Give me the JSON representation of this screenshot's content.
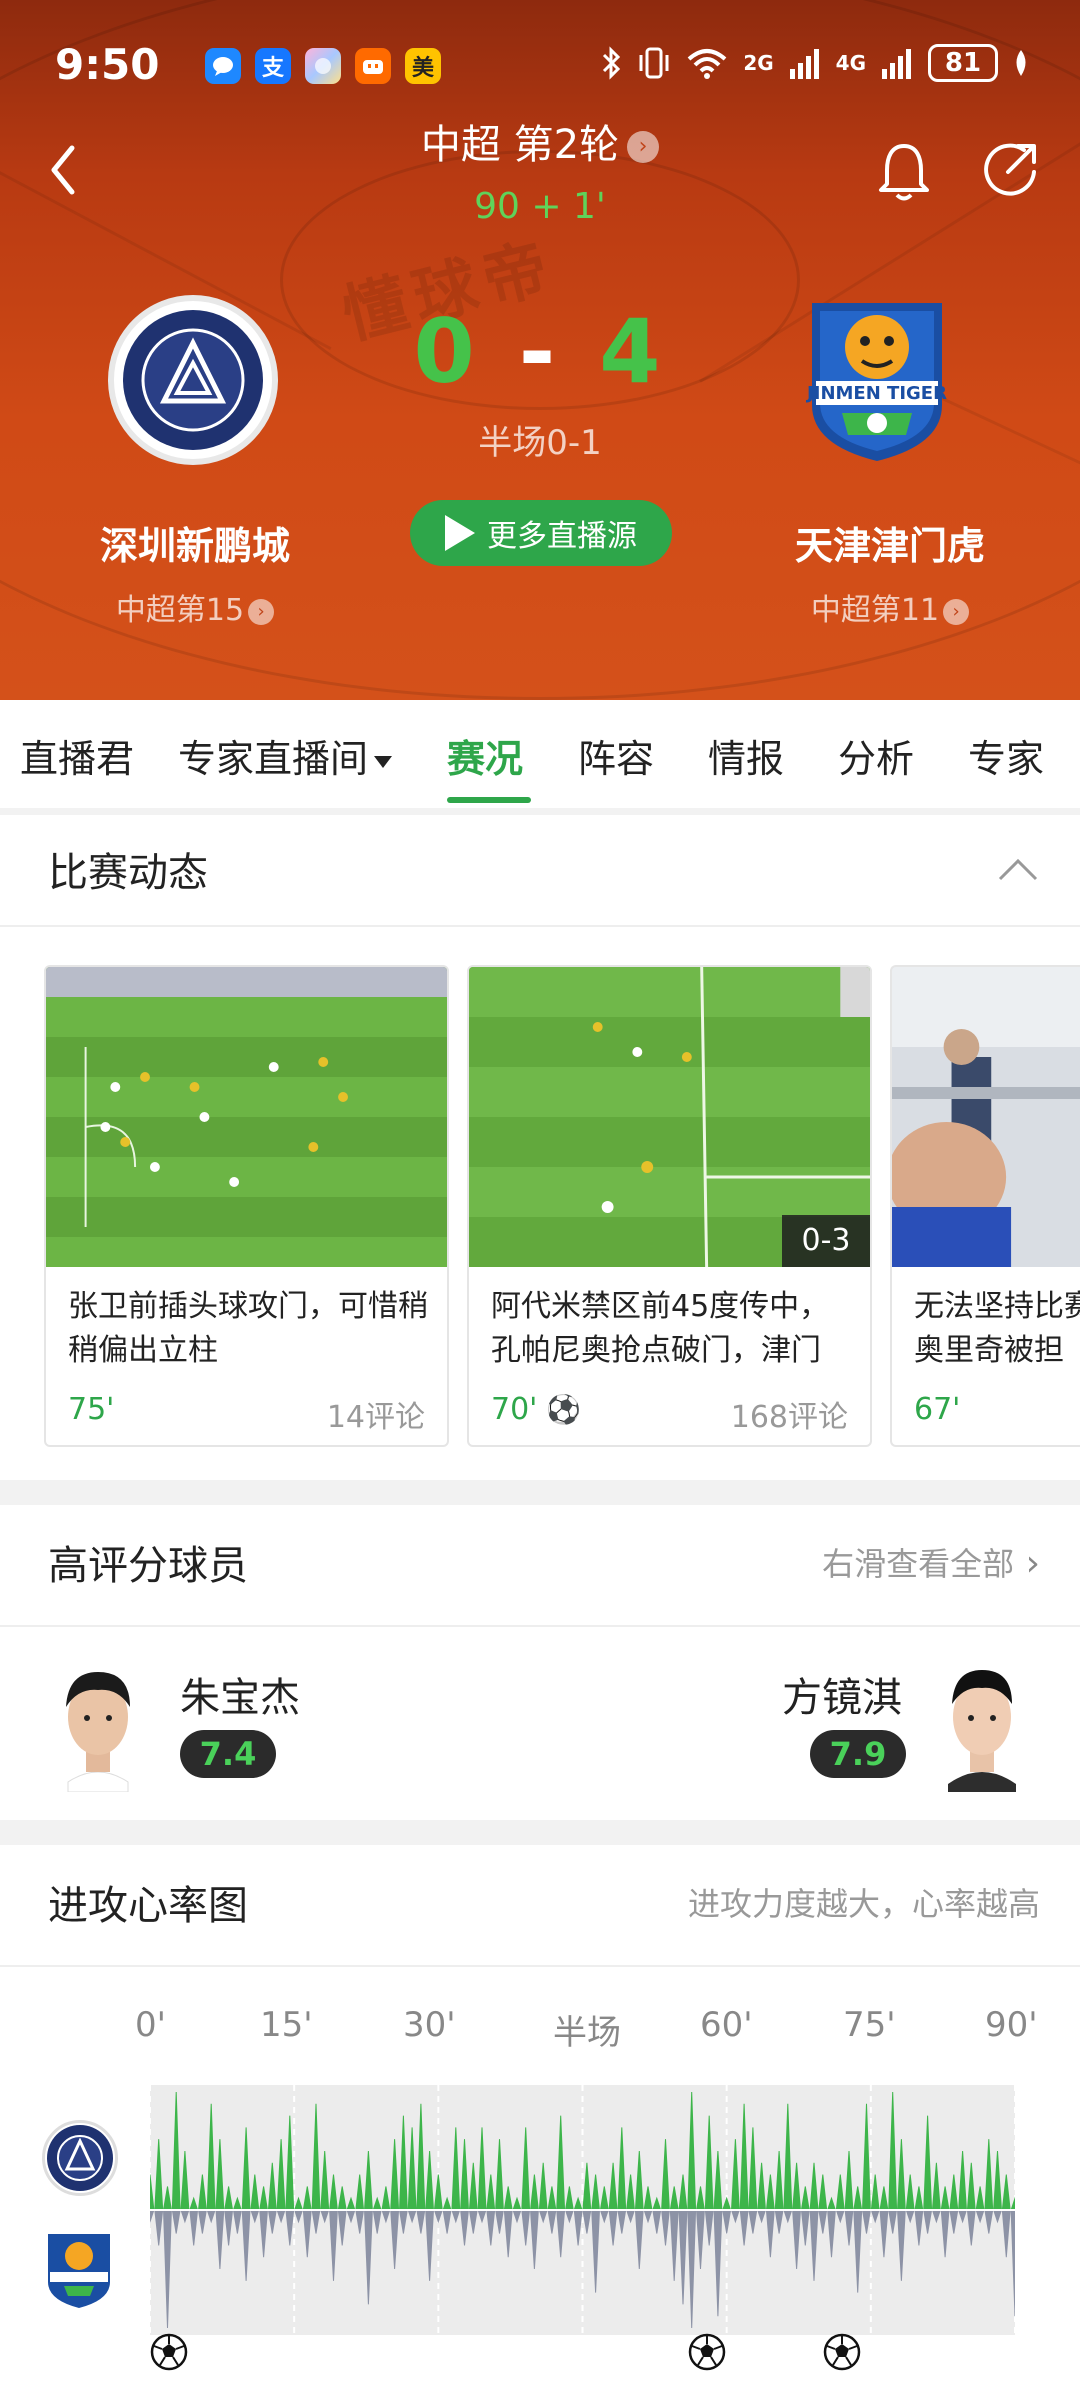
{
  "status_bar": {
    "time": "9:50",
    "app_icons": [
      "message-app",
      "alipay-app",
      "photos-app",
      "taobao-app",
      "meituan-app"
    ],
    "app_glyphs": [
      "",
      "支",
      "",
      "",
      "美"
    ],
    "network1": "2G",
    "network2": "4G",
    "battery": "81"
  },
  "header": {
    "league_round": "中超 第2轮",
    "minute": "90 + 1'",
    "home_team": "深圳新鹏城",
    "away_team": "天津津门虎",
    "home_score": "0",
    "away_score": "4",
    "score_separator": "-",
    "halftime": "半场0-1",
    "home_rank": "中超第15",
    "away_rank": "中超第11",
    "live_button": "更多直播源"
  },
  "tabs": [
    "直播君",
    "专家直播间",
    "赛况",
    "阵容",
    "情报",
    "分析",
    "专家"
  ],
  "active_tab": "赛况",
  "events_section": {
    "title": "比赛动态",
    "cards": [
      {
        "caption": "张卫前插头球攻门，可惜稍稍偏出立柱",
        "minute": "75'",
        "comments": "14评论",
        "badge": ""
      },
      {
        "caption": "阿代米禁区前45度传中，孔帕尼奥抢点破门，津门",
        "minute": "70'",
        "comments": "168评论",
        "badge": "0-3"
      },
      {
        "caption": "无法坚持比赛菲奥里奇被担",
        "minute": "67'",
        "comments": "",
        "badge": ""
      }
    ]
  },
  "top_players": {
    "title": "高评分球员",
    "more_link": "右滑查看全部",
    "home_player": {
      "name": "朱宝杰",
      "rating": "7.4"
    },
    "away_player": {
      "name": "方镜淇",
      "rating": "7.9"
    }
  },
  "heart_rate": {
    "title": "进攻心率图",
    "subtitle": "进攻力度越大，心率越高",
    "axis_labels": [
      "0'",
      "15'",
      "30'",
      "半场",
      "60'",
      "75'",
      "90'"
    ]
  },
  "chart_data": {
    "type": "area",
    "title": "进攻心率图",
    "x_range": [
      0,
      90
    ],
    "ticks": [
      "0'",
      "15'",
      "30'",
      "半场",
      "60'",
      "75'",
      "90'"
    ],
    "series": [
      {
        "name": "深圳新鹏城",
        "color": "#3db54a",
        "values": [
          0.3,
          0.6,
          0.2,
          1.0,
          0.5,
          0.1,
          0.3,
          0.9,
          0.6,
          0.2,
          0.1,
          0.7,
          0.3,
          0.2,
          0.4,
          0.6,
          0.8,
          0.1,
          0.2,
          0.9,
          0.5,
          0.3,
          0.2,
          0.1,
          0.3,
          0.5,
          0.1,
          0.2,
          0.6,
          0.8,
          0.7,
          0.9,
          0.5,
          0.3,
          0.1,
          0.7,
          0.6,
          0.4,
          0.7,
          0.3,
          0.6,
          0.2,
          0.1,
          0.7,
          0.3,
          0.4,
          0.2,
          0.8,
          0.2,
          0.1,
          0.4,
          0.3,
          0.2,
          0.4,
          0.7,
          0.3,
          0.5,
          0.2,
          0.1,
          0.6,
          0.2,
          0.3,
          1.0,
          0.2,
          0.8,
          0.5,
          0.1,
          0.6,
          0.9,
          0.7,
          0.4,
          0.3,
          0.5,
          0.9,
          0.4,
          0.2,
          0.4,
          0.3,
          0.1,
          0.3,
          0.5,
          0.2,
          0.9,
          0.3,
          0.2,
          1.0,
          0.6,
          0.3,
          0.2,
          0.8,
          0.4,
          0.2,
          0.3,
          0.5,
          0.4,
          0.2,
          0.6,
          0.5,
          0.3,
          0.1
        ]
      },
      {
        "name": "天津津门虎",
        "color": "#8d93a6",
        "values": [
          0.1,
          0.3,
          1.0,
          0.2,
          0.1,
          0.3,
          0.2,
          0.1,
          0.5,
          0.3,
          0.2,
          0.6,
          0.1,
          0.4,
          0.2,
          0.1,
          0.3,
          0.1,
          0.4,
          0.2,
          0.1,
          0.6,
          0.3,
          0.1,
          0.2,
          0.8,
          0.2,
          0.1,
          0.5,
          0.2,
          0.1,
          0.2,
          0.6,
          0.1,
          0.2,
          0.1,
          0.3,
          0.2,
          0.1,
          0.3,
          0.2,
          0.4,
          0.1,
          0.3,
          0.5,
          0.1,
          0.2,
          0.4,
          0.1,
          0.3,
          0.2,
          0.7,
          0.1,
          0.3,
          0.2,
          0.1,
          0.5,
          0.1,
          0.2,
          0.3,
          0.6,
          0.8,
          1.0,
          0.5,
          0.3,
          0.9,
          0.2,
          0.1,
          0.3,
          0.2,
          0.1,
          0.4,
          0.2,
          0.1,
          0.5,
          0.3,
          0.6,
          0.2,
          0.4,
          0.1,
          0.3,
          0.7,
          0.2,
          0.1,
          0.4,
          0.2,
          0.6,
          0.1,
          0.3,
          0.2,
          0.1,
          0.4,
          0.2,
          0.1,
          0.3,
          0.1,
          0.2,
          0.1,
          0.4,
          0.9
        ]
      }
    ],
    "goals_minutes": [
      2,
      58,
      72
    ],
    "grid_lines_minutes": [
      0,
      15,
      30,
      45,
      60,
      75,
      90
    ]
  }
}
